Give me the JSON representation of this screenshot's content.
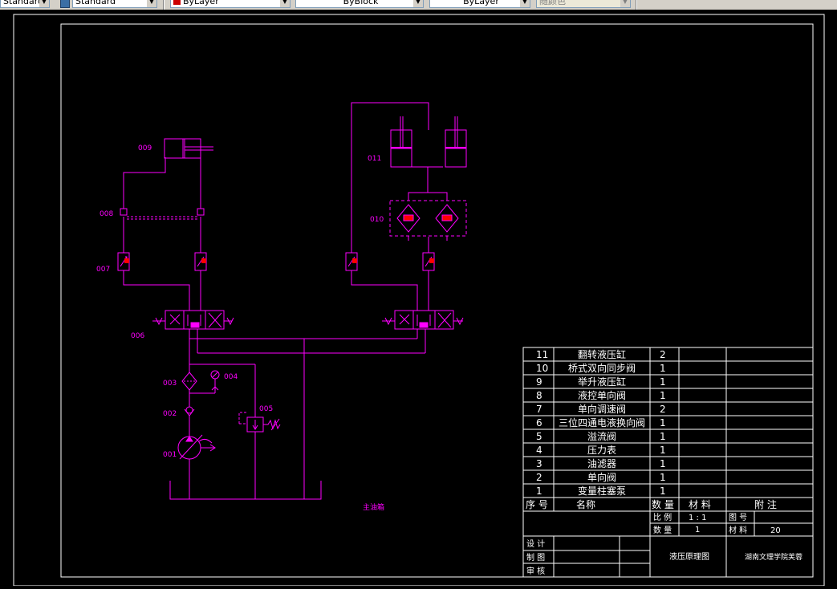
{
  "toolbar": {
    "text_style": "Standard",
    "dim_style": "Standard",
    "layer": "ByLayer",
    "linetype": "ByBlock",
    "lineweight": "ByLayer",
    "plotstyle": "随颜色",
    "layer_color": "#cc0000"
  },
  "colors": {
    "diagram": "#ff00ff",
    "table": "#ffffff",
    "frame": "#ffffff",
    "background": "#000000"
  },
  "labels": {
    "c001": "001",
    "c002": "002",
    "c003": "003",
    "c004": "004",
    "c005": "005",
    "c006": "006",
    "c007": "007",
    "c008": "008",
    "c009": "009",
    "c010": "010",
    "c011": "011",
    "tank": "主油箱"
  },
  "parts": [
    {
      "no": "11",
      "name": "翻转液压缸",
      "qty": "2"
    },
    {
      "no": "10",
      "name": "桥式双向同步阀",
      "qty": "1"
    },
    {
      "no": "9",
      "name": "举升液压缸",
      "qty": "1"
    },
    {
      "no": "8",
      "name": "液控单向阀",
      "qty": "1"
    },
    {
      "no": "7",
      "name": "单向调速阀",
      "qty": "2"
    },
    {
      "no": "6",
      "name": "三位四通电液换向阀",
      "qty": "1"
    },
    {
      "no": "5",
      "name": "溢流阀",
      "qty": "1"
    },
    {
      "no": "4",
      "name": "压力表",
      "qty": "1"
    },
    {
      "no": "3",
      "name": "油滤器",
      "qty": "1"
    },
    {
      "no": "2",
      "name": "单向阀",
      "qty": "1"
    },
    {
      "no": "1",
      "name": "变量柱塞泵",
      "qty": "1"
    }
  ],
  "headers": {
    "no": "序 号",
    "name": "名称",
    "qty": "数 量",
    "material": "材 料",
    "note": "附 注"
  },
  "title_block": {
    "scale_label": "比 例",
    "scale_value": "1 : 1",
    "drawing_no_label": "图 号",
    "count_label": "数 量",
    "count_value": "1",
    "material_label": "材 料",
    "material_value": "20",
    "design": "设 计",
    "draft": "制 图",
    "review": "审 核",
    "drawing_title": "液压原理图",
    "school": "湖南文理学院芙蓉"
  }
}
